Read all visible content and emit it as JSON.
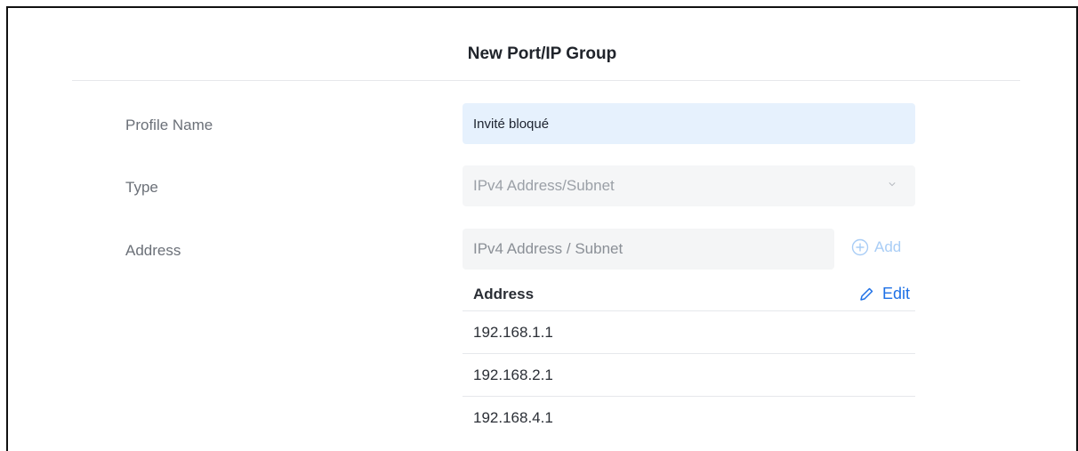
{
  "dialog": {
    "title": "New Port/IP Group"
  },
  "form": {
    "profile_name": {
      "label": "Profile Name",
      "value": "Invité bloqué"
    },
    "type": {
      "label": "Type",
      "selected": "IPv4 Address/Subnet"
    },
    "address": {
      "label": "Address",
      "placeholder": "IPv4 Address / Subnet",
      "add_label": "Add"
    }
  },
  "address_table": {
    "header": "Address",
    "edit_label": "Edit",
    "rows": [
      "192.168.1.1",
      "192.168.2.1",
      "192.168.4.1"
    ]
  },
  "colors": {
    "accent": "#1e70e6",
    "accent_disabled": "#a9cdf6",
    "input_active_bg": "#e6f1fd"
  },
  "icons": {
    "dropdown": "chevron-down-icon",
    "add": "plus-circle-icon",
    "edit": "pencil-icon"
  }
}
